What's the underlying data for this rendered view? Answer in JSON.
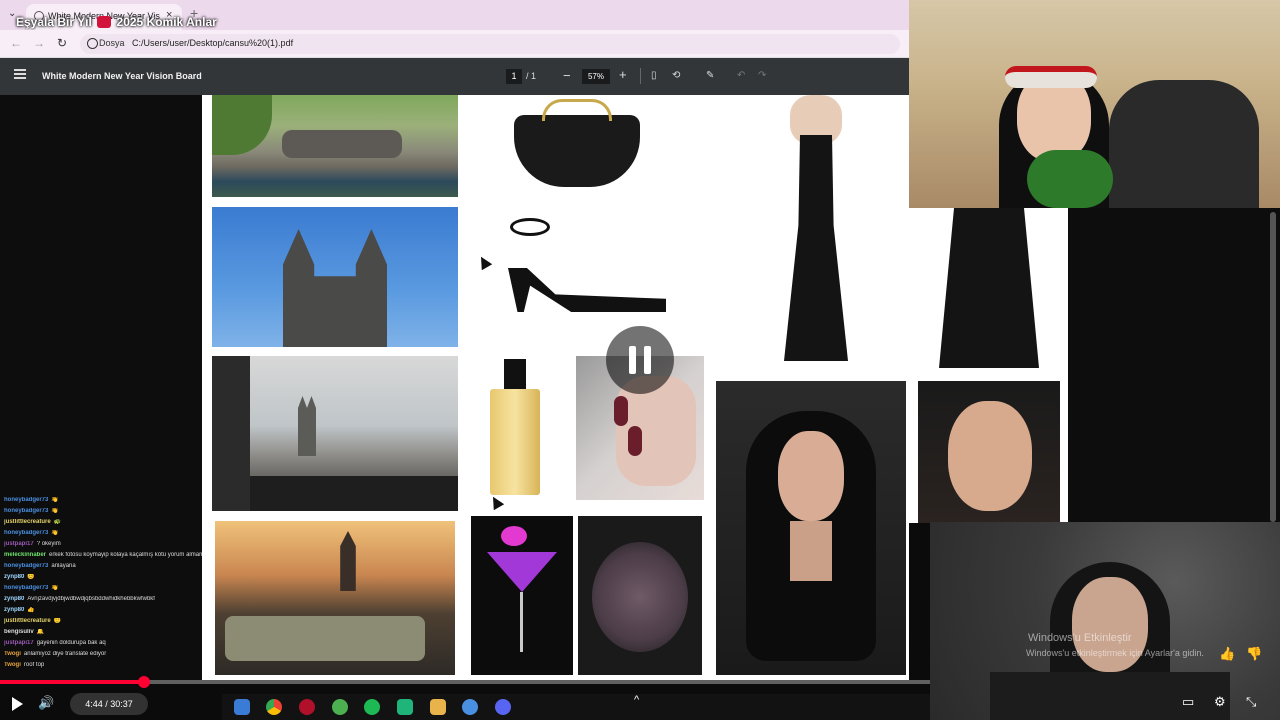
{
  "stream_overlay": {
    "title_before": "Eşya",
    "title_mid": "la Bir Yıl",
    "title_after": "2025 Komik Anlar"
  },
  "browser": {
    "tab_title": "White Modern New Year Vision",
    "tab_close": "×",
    "new_tab": "+",
    "security_chip": "Dosya",
    "url": "C:/Users/user/Desktop/cansu%20(1).pdf",
    "back": "←",
    "forward": "→",
    "reload": "↻"
  },
  "pdf_viewer": {
    "document_title": "White Modern New Year Vision Board",
    "current_page": "1",
    "page_separator": "/ 1",
    "zoom": "57%",
    "zoom_out": "−",
    "zoom_in": "+",
    "fit_icon": "▯",
    "rotate_icon": "⟲",
    "annotate_icon": "✎",
    "undo_icon": "↶",
    "redo_icon": "↷"
  },
  "chat": {
    "messages": [
      {
        "user": "honeybadger73",
        "text": "👋",
        "color": "#4a90e2"
      },
      {
        "user": "honeybadger73",
        "text": "👋",
        "color": "#4a90e2"
      },
      {
        "user": "justlittlecreature",
        "text": "🐢",
        "color": "#e6d36a"
      },
      {
        "user": "honeybadger73",
        "text": "👋",
        "color": "#4a90e2"
      },
      {
        "user": "justpapi17",
        "text": "? okeyim",
        "color": "#9b59b6"
      },
      {
        "user": "meleckinnaber",
        "text": "erkek fotosu koymayip kolaya kaçalmış kötü yorum almamak için",
        "color": "#6ee06e"
      },
      {
        "user": "honeybadger73",
        "text": "anlayana",
        "color": "#4a90e2"
      },
      {
        "user": "zynp80",
        "text": "😊",
        "color": "#a0d8ff"
      },
      {
        "user": "honeybadger73",
        "text": "👋",
        "color": "#4a90e2"
      },
      {
        "user": "zynp80",
        "text": "Avnjzavdjvjdbjwdbwdjqbsbddwhidkhebbkwfwbkf",
        "color": "#a0d8ff"
      },
      {
        "user": "zynp80",
        "text": "👍",
        "color": "#a0d8ff"
      },
      {
        "user": "justlittlecreature",
        "text": "🙂",
        "color": "#e6d36a"
      },
      {
        "user": "bengisuliv",
        "text": "🔔",
        "color": "#dddddd"
      },
      {
        "user": "justpapi17",
        "text": "gayenin doldurupa bak aq",
        "color": "#9b59b6"
      },
      {
        "user": "Twogi",
        "text": "anlamiyoz diye translate ediyor",
        "color": "#e6a23c"
      },
      {
        "user": "Twogi",
        "text": "roof top",
        "color": "#e6a23c"
      }
    ]
  },
  "webcam": {
    "activation_line1": "Windows'u Etkinleştir",
    "activation_line2": "Windows'u etkinleştirmek için Ayarlar'a gidin."
  },
  "player": {
    "time": "4:44 / 30:37",
    "progress_fraction": 0.155,
    "volume_icon": "🔊",
    "chevron": "^"
  },
  "colors": {
    "accent": "#ff0033",
    "pdf_toolbar": "#323639",
    "tab_strip": "#ecd9ec"
  }
}
